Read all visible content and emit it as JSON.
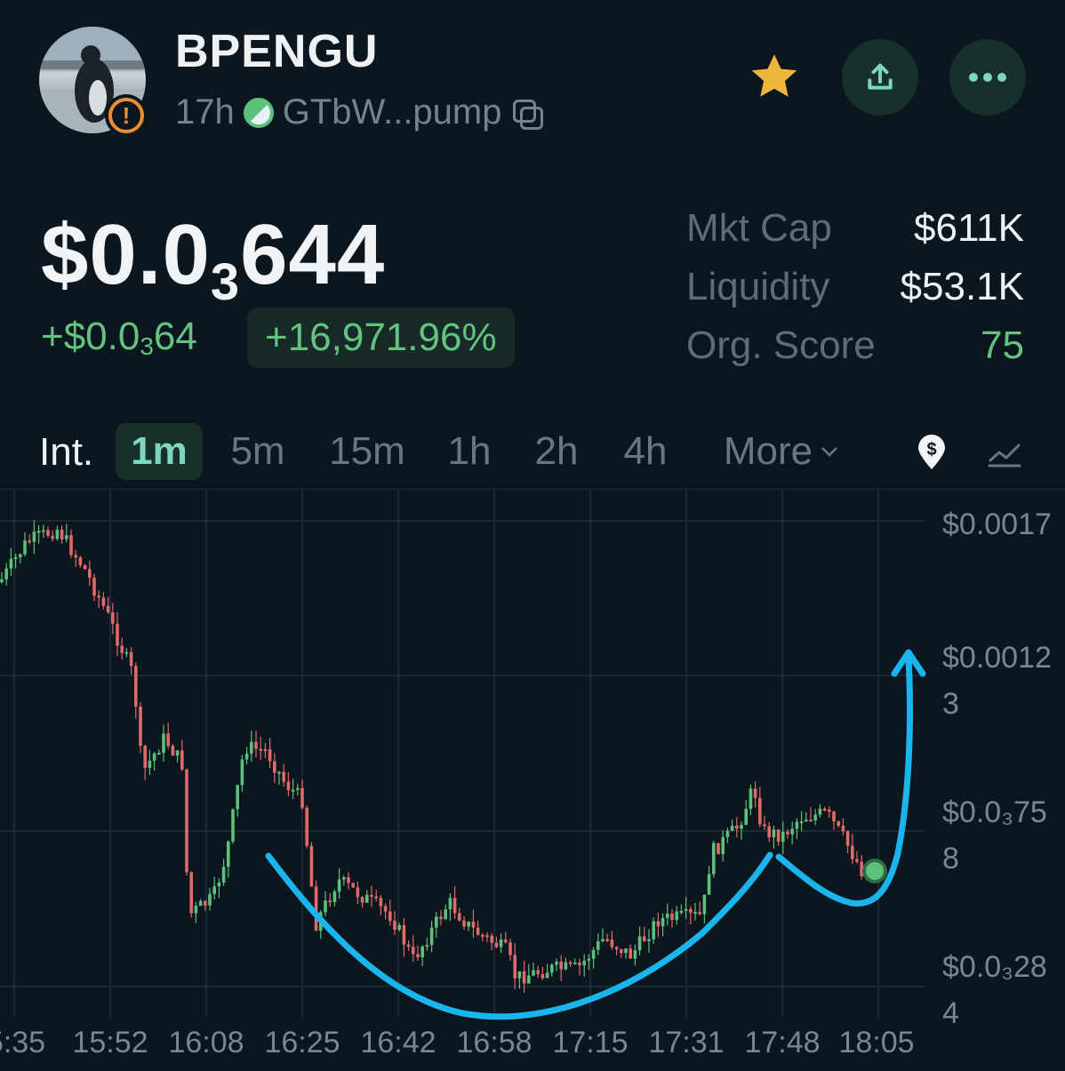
{
  "header": {
    "token_name": "BPENGU",
    "age": "17h",
    "address": "GTbW...pump",
    "icons": [
      "avatar-penguin",
      "warning-icon",
      "pill-icon",
      "copy-icon",
      "star-icon",
      "share-icon",
      "more-icon"
    ],
    "star_color": "#f0b53c",
    "warning_color": "#e8902d"
  },
  "price": {
    "prefix": "$0.0",
    "zeros": "3",
    "digits": "644",
    "change_prefix": "+$0.0",
    "change_zeros": "3",
    "change_digits": "64",
    "change_pct": "+16,971.96%"
  },
  "stats": [
    {
      "label": "Mkt Cap",
      "value": "$611K"
    },
    {
      "label": "Liquidity",
      "value": "$53.1K"
    },
    {
      "label": "Org. Score",
      "value": "75",
      "color": "#63c47f"
    }
  ],
  "intervals": {
    "label": "Int.",
    "tabs": [
      "1m",
      "5m",
      "15m",
      "1h",
      "2h",
      "4h",
      "More"
    ],
    "active": "1m"
  },
  "chart": {
    "y_labels": [
      "$0.0017",
      "$0.0012\n3",
      "$0.0₃75\n8",
      "$0.0₃28\n4"
    ],
    "x_labels": [
      "5:35",
      "15:52",
      "16:08",
      "16:25",
      "16:42",
      "16:58",
      "17:15",
      "17:31",
      "17:48",
      "18:05"
    ],
    "up_color": "#5cc07a",
    "down_color": "#e06a6a",
    "annotation_color": "#19b5ec"
  }
}
